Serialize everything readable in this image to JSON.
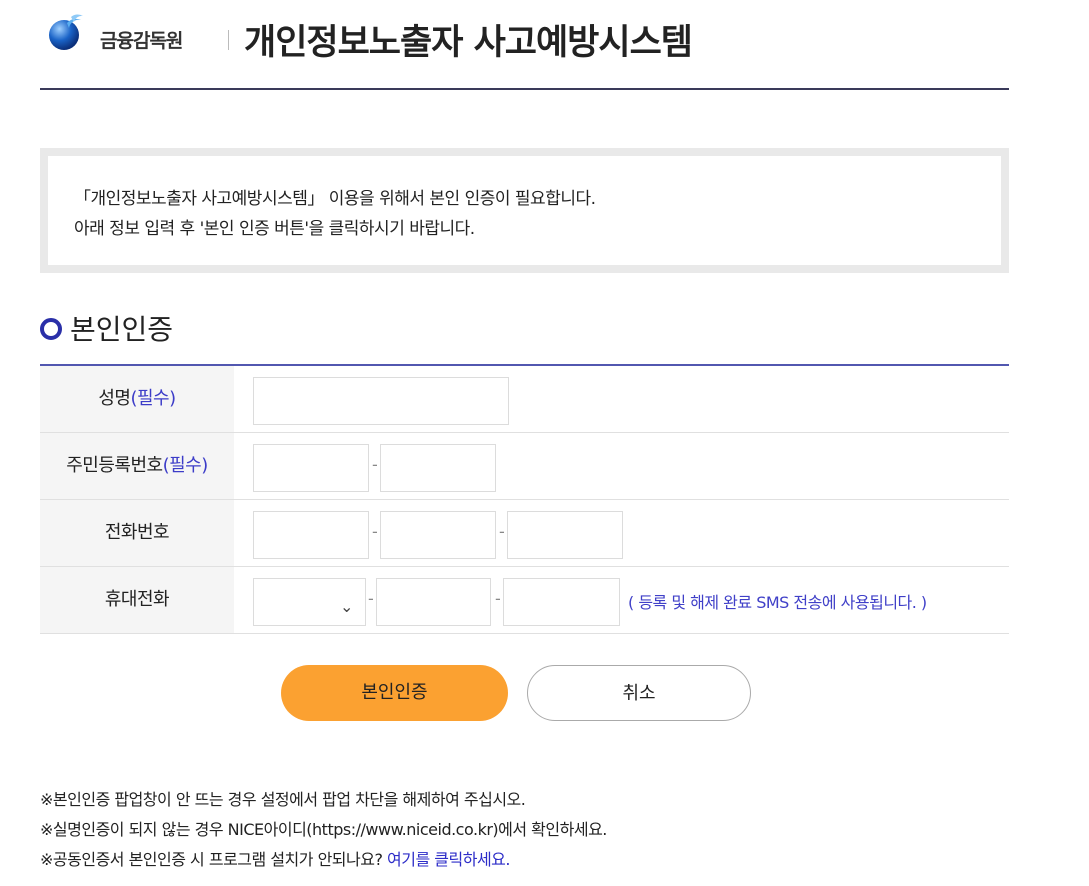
{
  "header": {
    "org_name": "금융감독원",
    "site_title": "개인정보노출자 사고예방시스템"
  },
  "notice": {
    "line1": "「개인정보노출자 사고예방시스템」 이용을 위해서 본인 인증이 필요합니다.",
    "line2": "아래 정보 입력 후 '본인 인증 버튼'을 클릭하시기 바랍니다."
  },
  "section": {
    "title": "본인인증"
  },
  "form": {
    "required_tag": "(필수)",
    "name": {
      "label": "성명",
      "value": ""
    },
    "ssn": {
      "label": "주민등록번호",
      "part1": "",
      "part2": ""
    },
    "phone": {
      "label": "전화번호",
      "part1": "",
      "part2": "",
      "part3": ""
    },
    "mobile": {
      "label": "휴대전화",
      "carrier_selected": "",
      "part2": "",
      "part3": "",
      "hint": "( 등록 및 해제 완료 SMS 전송에 사용됩니다. )"
    },
    "separator": "-"
  },
  "buttons": {
    "confirm_label": "본인인증",
    "cancel_label": "취소"
  },
  "footer": {
    "note1": "※본인인증 팝업창이 안 뜨는 경우 설정에서 팝업 차단을 해제하여 주십시오.",
    "note2": "※실명인증이 되지 않는 경우 NICE아이디(https://www.niceid.co.kr)에서 확인하세요.",
    "note3_prefix": "※공동인증서 본인인증 시 프로그램 설치가 안되나요? ",
    "note3_link": "여기를 클릭하세요."
  },
  "icons": {
    "logo": "fss-globe-logo",
    "section_bullet": "ring-icon",
    "select_arrow": "chevron-down-icon"
  },
  "colors": {
    "primary_button": "#fba131",
    "required": "#3c3cc8",
    "section_bullet": "#2a2fa8",
    "form_top_border": "#5257b0"
  }
}
